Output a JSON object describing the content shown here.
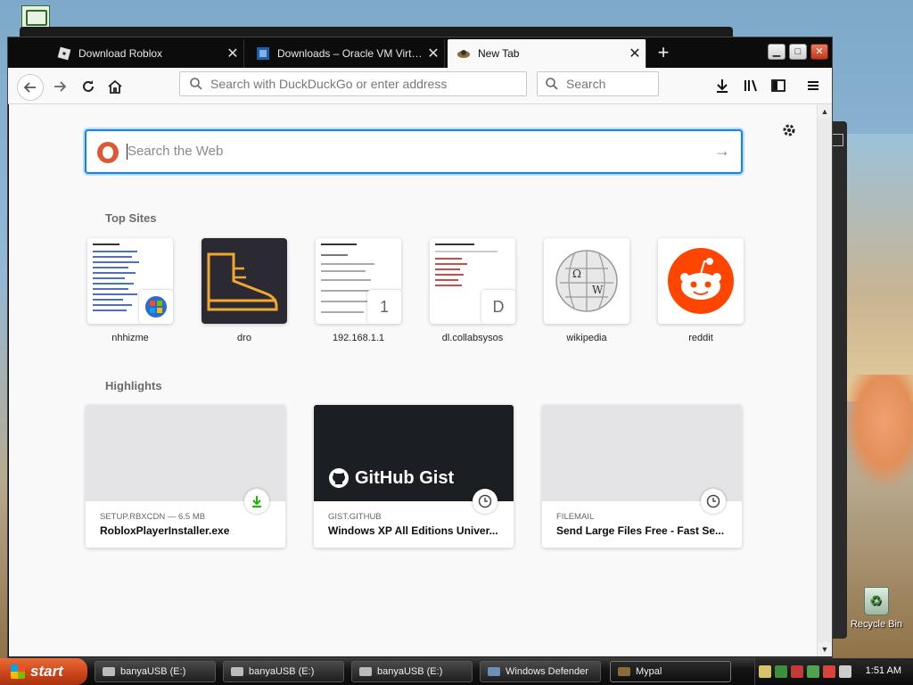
{
  "browser": {
    "tabs": [
      {
        "title": "Download Roblox",
        "active": false
      },
      {
        "title": "Downloads – Oracle VM VirtualBox",
        "active": false
      },
      {
        "title": "New Tab",
        "active": true
      }
    ],
    "new_tab_glyph": "+",
    "urlbar_placeholder": "Search with DuckDuckGo or enter address",
    "searchbar_placeholder": "Search"
  },
  "newtab": {
    "search_placeholder": "Search the Web",
    "top_sites_title": "Top Sites",
    "top_sites": [
      {
        "label": "nhhizme",
        "badge": ""
      },
      {
        "label": "dro",
        "badge": ""
      },
      {
        "label": "192.168.1.1",
        "badge": "1"
      },
      {
        "label": "dl.collabsysos",
        "badge": "D"
      },
      {
        "label": "wikipedia",
        "badge": ""
      },
      {
        "label": "reddit",
        "badge": ""
      }
    ],
    "highlights_title": "Highlights",
    "highlights": [
      {
        "context": "SETUP.RBXCDN — 6.5 MB",
        "title": "RobloxPlayerInstaller.exe",
        "icon": "download-icon"
      },
      {
        "context": "GIST.GITHUB",
        "title": "Windows XP All Editions Univer...",
        "image_text": "GitHub Gist",
        "icon": "clock-icon"
      },
      {
        "context": "FILEMAIL",
        "title": "Send Large Files Free - Fast Se...",
        "icon": "clock-icon"
      }
    ]
  },
  "desktop": {
    "recycle_bin_label": "Recycle Bin"
  },
  "taskbar": {
    "start_label": "start",
    "items": [
      {
        "label": "banyaUSB (E:)"
      },
      {
        "label": "banyaUSB (E:)"
      },
      {
        "label": "banyaUSB (E:)"
      },
      {
        "label": "Windows Defender"
      },
      {
        "label": "Mypal"
      }
    ],
    "clock": "1:51 AM"
  },
  "colors": {
    "accent": "#0a84ff",
    "ddg": "#de5833",
    "reddit": "#ff4500",
    "start": "#c9431a"
  }
}
